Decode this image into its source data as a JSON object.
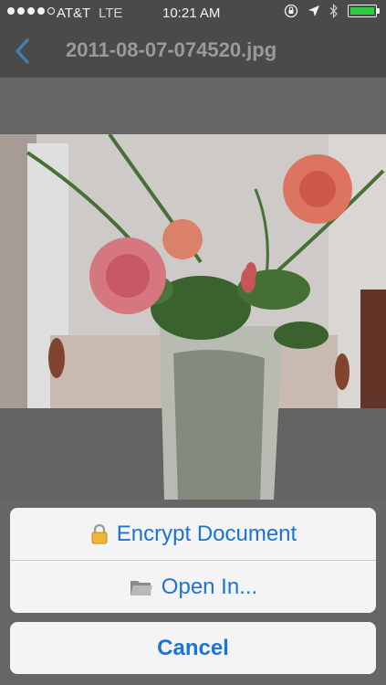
{
  "status_bar": {
    "carrier": "AT&T",
    "network": "LTE",
    "time": "10:21 AM",
    "signal_bars_filled": 4,
    "signal_bars_total": 5,
    "battery_level": 0.85,
    "icons": [
      "lock-rotation-icon",
      "location-arrow-icon",
      "bluetooth-icon",
      "battery-icon"
    ]
  },
  "nav": {
    "title": "2011-08-07-074520.jpg",
    "back_icon": "chevron-left-icon"
  },
  "colors": {
    "accent": "#1a73d6",
    "nav_background": "#4a4a4a",
    "battery_fill": "#2ecc40"
  },
  "action_sheet": {
    "items": [
      {
        "label": "Encrypt Document",
        "icon": "padlock-icon"
      },
      {
        "label": "Open In...",
        "icon": "folder-icon"
      }
    ],
    "cancel_label": "Cancel"
  }
}
